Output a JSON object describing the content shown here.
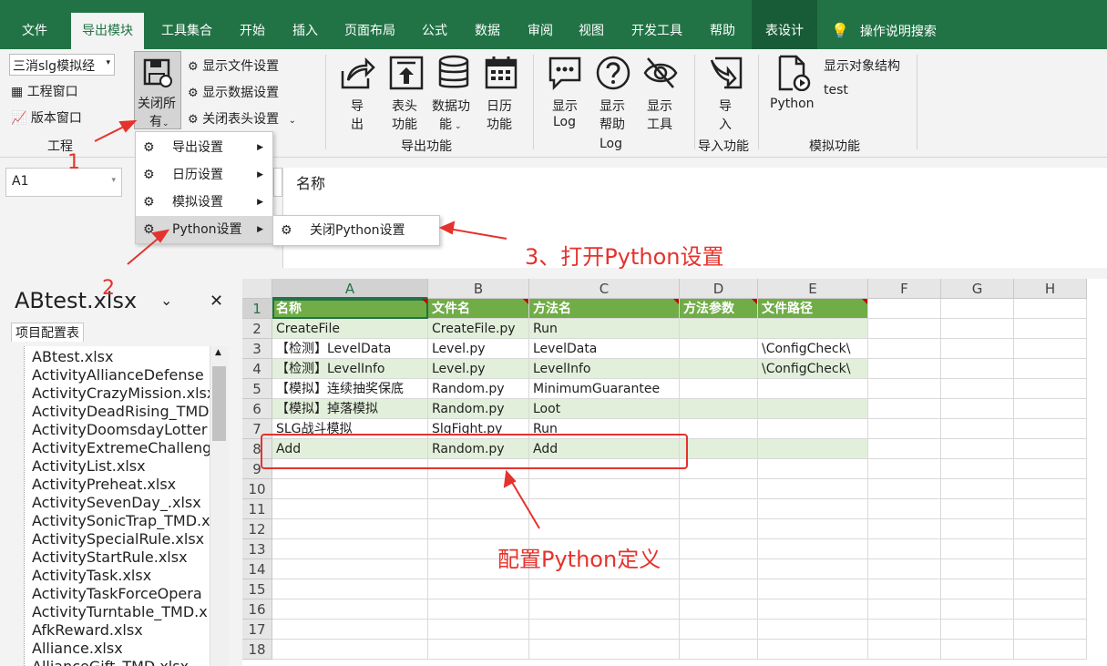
{
  "tabs": [
    "文件",
    "导出模块",
    "工具集合",
    "开始",
    "插入",
    "页面布局",
    "公式",
    "数据",
    "审阅",
    "视图",
    "开发工具",
    "帮助",
    "表设计"
  ],
  "tell_me": "操作说明搜索",
  "ribbon": {
    "project_dropdown": "三消slg模拟经",
    "project_window": "工程窗口",
    "version_window": "版本窗口",
    "group_project": "工程",
    "close_all_line1": "关闭所",
    "close_all_line2": "有",
    "show_file_settings": "显示文件设置",
    "show_data_settings": "显示数据设置",
    "close_header_settings": "关闭表头设置",
    "export_line1": "导",
    "export_line2": "出",
    "header_line1": "表头",
    "header_line2": "功能",
    "data_line1": "数据功",
    "data_line2": "能",
    "calendar_line1": "日历",
    "calendar_line2": "功能",
    "group_export": "导出功能",
    "show_log_line1": "显示",
    "show_log_line2": "Log",
    "show_help_line1": "显示",
    "show_help_line2": "帮助",
    "show_tools_line1": "显示",
    "show_tools_line2": "工具",
    "group_log": "Log",
    "import_line1": "导",
    "import_line2": "入",
    "group_import": "导入功能",
    "python": "Python",
    "show_object_structure": "显示对象结构",
    "test": "test",
    "group_sim": "模拟功能"
  },
  "menu": {
    "items": [
      "导出设置",
      "日历设置",
      "模拟设置",
      "Python设置"
    ],
    "submenu_item": "关闭Python设置"
  },
  "annotations": {
    "a1": "1",
    "a2": "2",
    "a3": "3、打开Python设置",
    "a4": "配置Python定义"
  },
  "namebox": "A1",
  "formula_value": "名称",
  "sidepane": {
    "title": "ABtest.xlsx",
    "tab": "项目配置表",
    "files": [
      "ABtest.xlsx",
      "ActivityAllianceDefense",
      "ActivityCrazyMission.xlsx",
      "ActivityDeadRising_TMD",
      "ActivityDoomsdayLotter",
      "ActivityExtremeChalleng",
      "ActivityList.xlsx",
      "ActivityPreheat.xlsx",
      "ActivitySevenDay_.xlsx",
      "ActivitySonicTrap_TMD.x",
      "ActivitySpecialRule.xlsx",
      "ActivityStartRule.xlsx",
      "ActivityTask.xlsx",
      "ActivityTaskForceOpera",
      "ActivityTurntable_TMD.x",
      "AfkReward.xlsx",
      "Alliance.xlsx",
      "AllianceGift_TMD.xlsx"
    ]
  },
  "grid": {
    "columns": [
      "A",
      "B",
      "C",
      "D",
      "E",
      "F",
      "G",
      "H"
    ],
    "rows": [
      "1",
      "2",
      "3",
      "4",
      "5",
      "6",
      "7",
      "8",
      "9",
      "10",
      "11",
      "12",
      "13",
      "14",
      "15",
      "16",
      "17",
      "18"
    ],
    "header": [
      "名称",
      "文件名",
      "方法名",
      "方法参数",
      "文件路径"
    ],
    "data": [
      [
        "CreateFile",
        "CreateFile.py",
        "Run",
        "",
        ""
      ],
      [
        "【检测】LevelData",
        "Level.py",
        "LevelData",
        "",
        "\\ConfigCheck\\"
      ],
      [
        "【检测】LevelInfo",
        "Level.py",
        "LevelInfo",
        "",
        "\\ConfigCheck\\"
      ],
      [
        "【模拟】连续抽奖保底",
        "Random.py",
        "MinimumGuarantee",
        "",
        ""
      ],
      [
        "【模拟】掉落模拟",
        "Random.py",
        "Loot",
        "",
        ""
      ],
      [
        "SLG战斗模拟",
        "SlgFight.py",
        "Run",
        "",
        ""
      ],
      [
        "Add",
        "Random.py",
        "Add",
        "",
        ""
      ]
    ]
  }
}
